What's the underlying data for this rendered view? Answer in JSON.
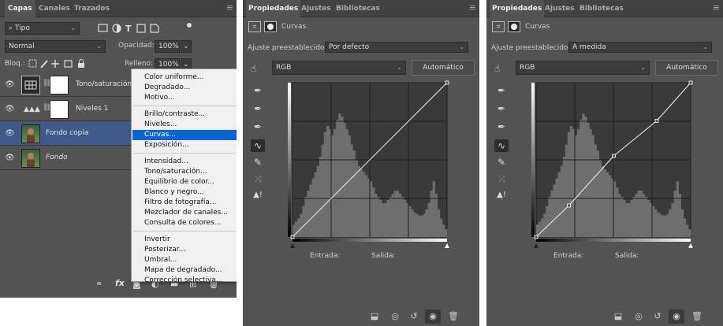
{
  "layers_panel": {
    "tabs": [
      "Capas",
      "Canales",
      "Trazados"
    ],
    "filter_value": "Tipo",
    "blend_mode": "Normal",
    "opacity_label": "Opacidad:",
    "opacity_value": "100%",
    "lock_label": "Bloq.:",
    "fill_label": "Relleno:",
    "fill_value": "100%",
    "layers": [
      {
        "name": "Tono/saturación",
        "selected": false
      },
      {
        "name": "Niveles 1",
        "selected": false
      },
      {
        "name": "Fondo copia",
        "selected": true
      },
      {
        "name": "Fondo",
        "selected": false
      }
    ],
    "menu_groups": [
      [
        "Color uniforme...",
        "Degradado...",
        "Motivo..."
      ],
      [
        "Brillo/contraste...",
        "Niveles...",
        "Curvas...",
        "Exposición..."
      ],
      [
        "Intensidad...",
        "Tono/saturación...",
        "Equilibrio de color...",
        "Blanco y negro...",
        "Filtro de fotografía...",
        "Mezclador de canales...",
        "Consulta de colores..."
      ],
      [
        "Invertir",
        "Posterizar...",
        "Umbral...",
        "Mapa de degradado...",
        "Corrección selectiva..."
      ]
    ],
    "selected_menu_item": "Curvas..."
  },
  "curves_panels": [
    {
      "tabs": [
        "Propiedades",
        "Ajustes",
        "Bibliotecas"
      ],
      "title": "Curvas",
      "preset_label": "Ajuste preestablecido:",
      "preset_value": "Por defecto",
      "channel": "RGB",
      "auto_label": "Automático",
      "input_label": "Entrada:",
      "output_label": "Salida:",
      "curve_points": [
        [
          0,
          0
        ],
        [
          255,
          255
        ]
      ]
    },
    {
      "tabs": [
        "Propiedades",
        "Ajustes",
        "Bibliotecas"
      ],
      "title": "Curvas",
      "preset_label": "Ajuste preestablecido:",
      "preset_value": "A medida",
      "channel": "RGB",
      "auto_label": "Automático",
      "input_label": "Entrada:",
      "output_label": "Salida:",
      "curve_points": [
        [
          0,
          0
        ],
        [
          54,
          52
        ],
        [
          128,
          134
        ],
        [
          199,
          192
        ],
        [
          255,
          255
        ]
      ]
    }
  ],
  "histogram": [
    8,
    10,
    12,
    15,
    20,
    26,
    30,
    34,
    38,
    42,
    46,
    52,
    60,
    68,
    72,
    70,
    66,
    70,
    76,
    80,
    78,
    74,
    70,
    66,
    60,
    56,
    50,
    46,
    44,
    42,
    40,
    38,
    36,
    32,
    28,
    26,
    24,
    22,
    22,
    24,
    26,
    28,
    30,
    30,
    28,
    26,
    24,
    22,
    20,
    18,
    16,
    15,
    14,
    14,
    15,
    18,
    22,
    30,
    36,
    28,
    18,
    12,
    8,
    5
  ]
}
